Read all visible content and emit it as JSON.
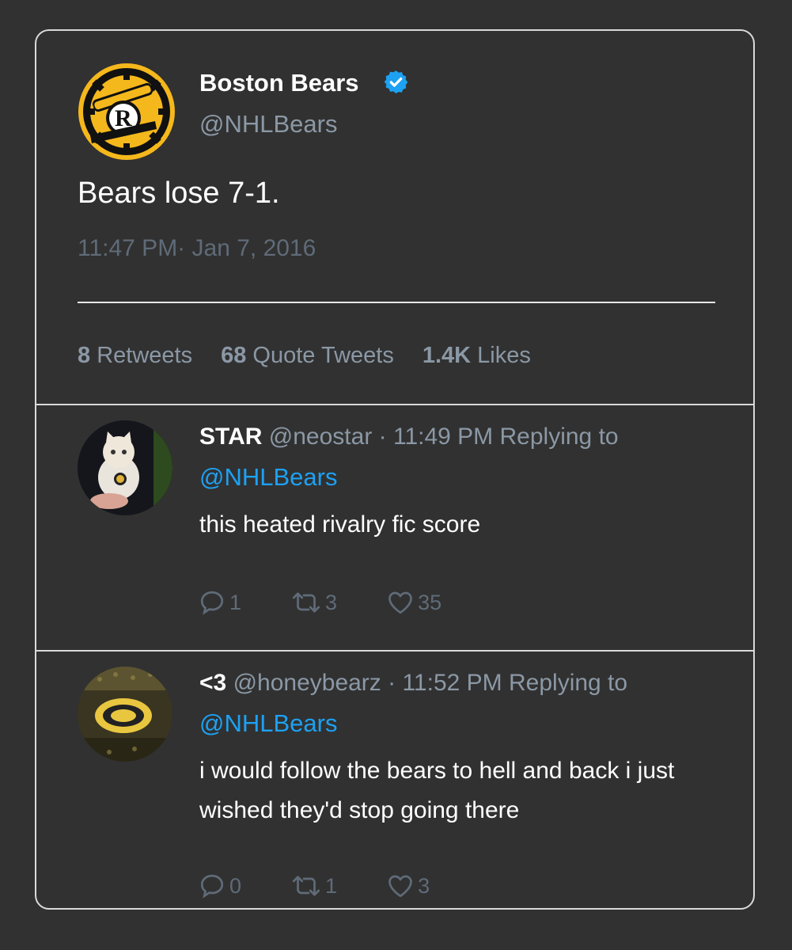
{
  "main_tweet": {
    "display_name": "Boston Bears",
    "handle": "@NHLBears",
    "text": "Bears lose 7-1.",
    "timestamp": "11:47 PM· Jan 7, 2016",
    "stats": {
      "retweets_count": "8",
      "retweets_label": "Retweets",
      "quotes_count": "68",
      "quotes_label": "Quote Tweets",
      "likes_count": "1.4K",
      "likes_label": "Likes"
    },
    "avatar_icon": "boston-bears-cannon-logo-icon",
    "avatar_logo_letter": "R"
  },
  "replies": [
    {
      "display_name": "STAR",
      "handle": "@neostar",
      "meta": " · 11:49 PM Replying to",
      "mention": "@NHLBears",
      "text": "this heated rivalry fic score",
      "reply_count": "1",
      "retweet_count": "3",
      "like_count": "35",
      "avatar_icon": "kitten-photo-icon"
    },
    {
      "display_name": "<3",
      "handle": "@honeybearz",
      "meta": " · 11:52 PM Replying to",
      "mention": "@NHLBears",
      "text": "i would follow the bears to hell and back i just wished they'd stop going there",
      "reply_count": "0",
      "retweet_count": "1",
      "like_count": "3",
      "avatar_icon": "arena-logo-photo-icon"
    }
  ],
  "colors": {
    "background": "#313131",
    "border": "#d9d9d9",
    "muted_text": "#8b98a5",
    "link": "#1da1f2",
    "verified": "#1da1f2",
    "logo_gold": "#f5b81c"
  }
}
